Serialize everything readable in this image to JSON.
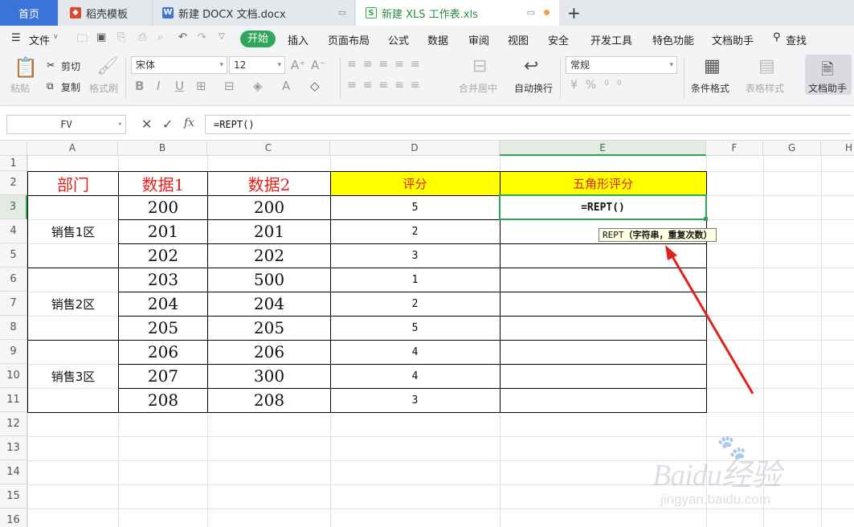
{
  "tabs": {
    "home": "首页",
    "template": "稻壳模板",
    "docx": "新建 DOCX 文档.docx",
    "xls": "新建 XLS 工作表.xls",
    "new_tab": "+"
  },
  "menu": {
    "file": "文件",
    "start": "开始",
    "items": [
      "插入",
      "页面布局",
      "公式",
      "数据",
      "审阅",
      "视图",
      "安全",
      "开发工具",
      "特色功能",
      "文档助手"
    ],
    "search": "查找"
  },
  "ribbon": {
    "cut": "剪切",
    "copy": "复制",
    "paste": "粘贴",
    "format_painter": "格式刷",
    "font_name": "宋体",
    "font_size": "12",
    "merge_center": "合并居中",
    "wrap_text": "自动换行",
    "number_format": "常规",
    "conditional_format": "条件格式",
    "table_style": "表格样式",
    "doc_assistant": "文档助手"
  },
  "formula_bar": {
    "name_box": "FV",
    "formula": "=REPT()"
  },
  "columns": [
    "A",
    "B",
    "C",
    "D",
    "E",
    "F",
    "G",
    "H"
  ],
  "rows": [
    "1",
    "2",
    "3",
    "4",
    "5",
    "6",
    "7",
    "8",
    "9",
    "10",
    "11",
    "12",
    "13",
    "14",
    "15",
    "16"
  ],
  "table": {
    "headers": [
      "部门",
      "数据1",
      "数据2",
      "评分",
      "五角形评分"
    ],
    "departments": [
      "销售1区",
      "销售2区",
      "销售3区"
    ],
    "data1": [
      "200",
      "201",
      "202",
      "203",
      "204",
      "205",
      "206",
      "207",
      "208"
    ],
    "data2": [
      "200",
      "201",
      "202",
      "500",
      "204",
      "205",
      "206",
      "300",
      "208"
    ],
    "scores": [
      "5",
      "2",
      "3",
      "1",
      "2",
      "5",
      "4",
      "4",
      "3"
    ]
  },
  "active_cell": {
    "content": "=REPT()",
    "tooltip_func": "REPT",
    "tooltip_args": "（字符串，重复次数）"
  },
  "colors": {
    "accent_green": "#2fa65a",
    "header_red": "#e0221b",
    "header_yellow": "#ffff00",
    "arrow_red": "#e0221b"
  },
  "watermark": {
    "main": "Baidu经验",
    "sub": "jingyan.baidu.com"
  }
}
